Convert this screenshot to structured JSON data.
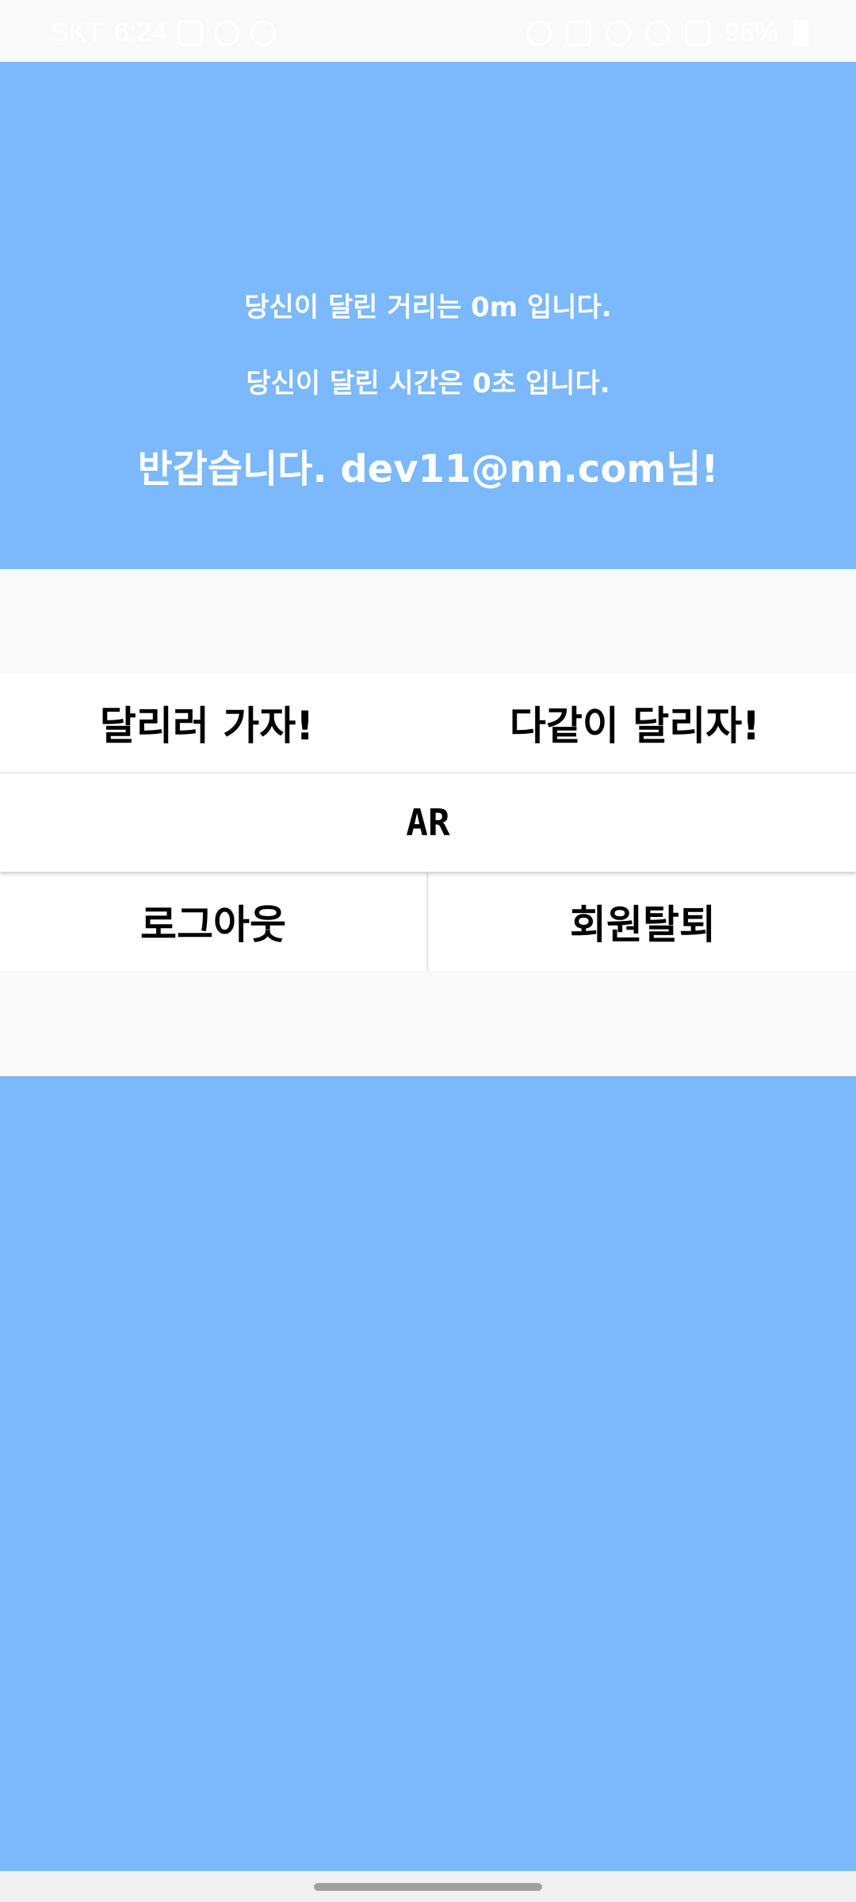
{
  "status_bar": {
    "carrier": "SKT",
    "time": "6:24",
    "battery_percent": "96%",
    "left_icons": [
      "gallery-icon",
      "chat-icon",
      "lightbulb-icon"
    ],
    "right_icons": [
      "nfc-icon",
      "volte-icon",
      "location-icon",
      "wifi-icon",
      "signal-icon",
      "battery-icon"
    ]
  },
  "top_panel": {
    "distance_text": "당신이 달린 거리는 0m 입니다.",
    "time_text": "당신이 달린 시간은 0초 입니다.",
    "welcome_text": "반갑습니다. dev11@nn.com님!"
  },
  "buttons": {
    "run": "달리러 가자!",
    "run_together": "다같이 달리자!",
    "ar": "AR",
    "logout": "로그아웃",
    "withdraw": "회원탈퇴"
  },
  "colors": {
    "panel_blue": "#7bb8fc",
    "background": "#f9f9f9",
    "button_bg": "#ffffff",
    "button_text": "#000000"
  }
}
